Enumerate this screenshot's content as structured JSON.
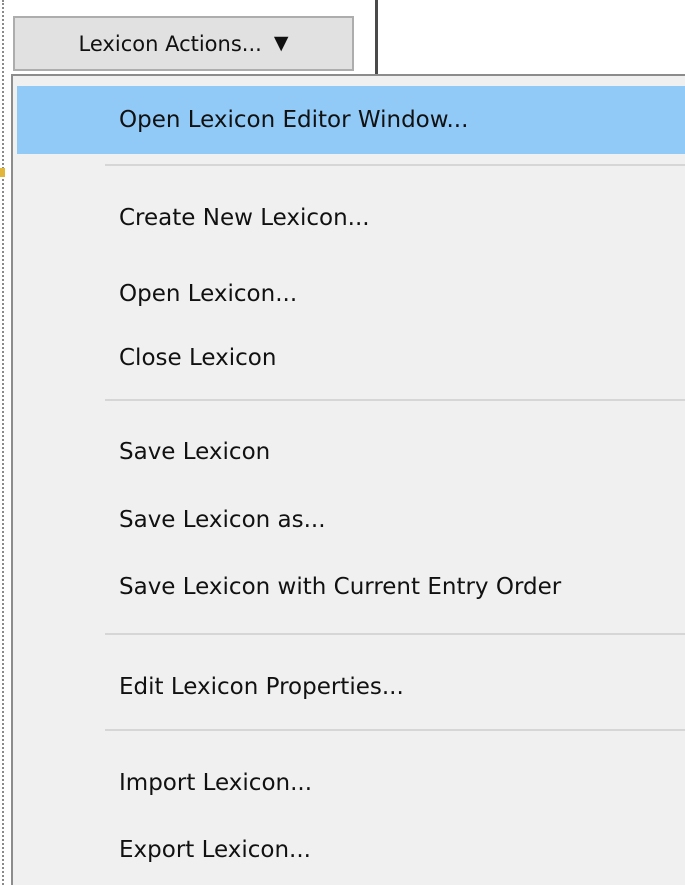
{
  "toolbar": {
    "button_label": "Lexicon Actions...",
    "button_arrow": "▼",
    "arrow_icon": "triangle-down-icon"
  },
  "menu": {
    "items": [
      {
        "label": "Open Lexicon Editor Window...",
        "highlighted": true
      },
      {
        "label": "Create New Lexicon..."
      },
      {
        "label": "Open Lexicon..."
      },
      {
        "label": "Close Lexicon"
      },
      {
        "label": "Save Lexicon"
      },
      {
        "label": "Save Lexicon as..."
      },
      {
        "label": "Save Lexicon with Current Entry Order"
      },
      {
        "label": "Edit Lexicon Properties..."
      },
      {
        "label": "Import Lexicon..."
      },
      {
        "label": "Export Lexicon..."
      }
    ]
  },
  "colors": {
    "highlight": "#91c9f7",
    "menu_background": "#f0f0f0",
    "button_background": "#e1e1e1"
  }
}
